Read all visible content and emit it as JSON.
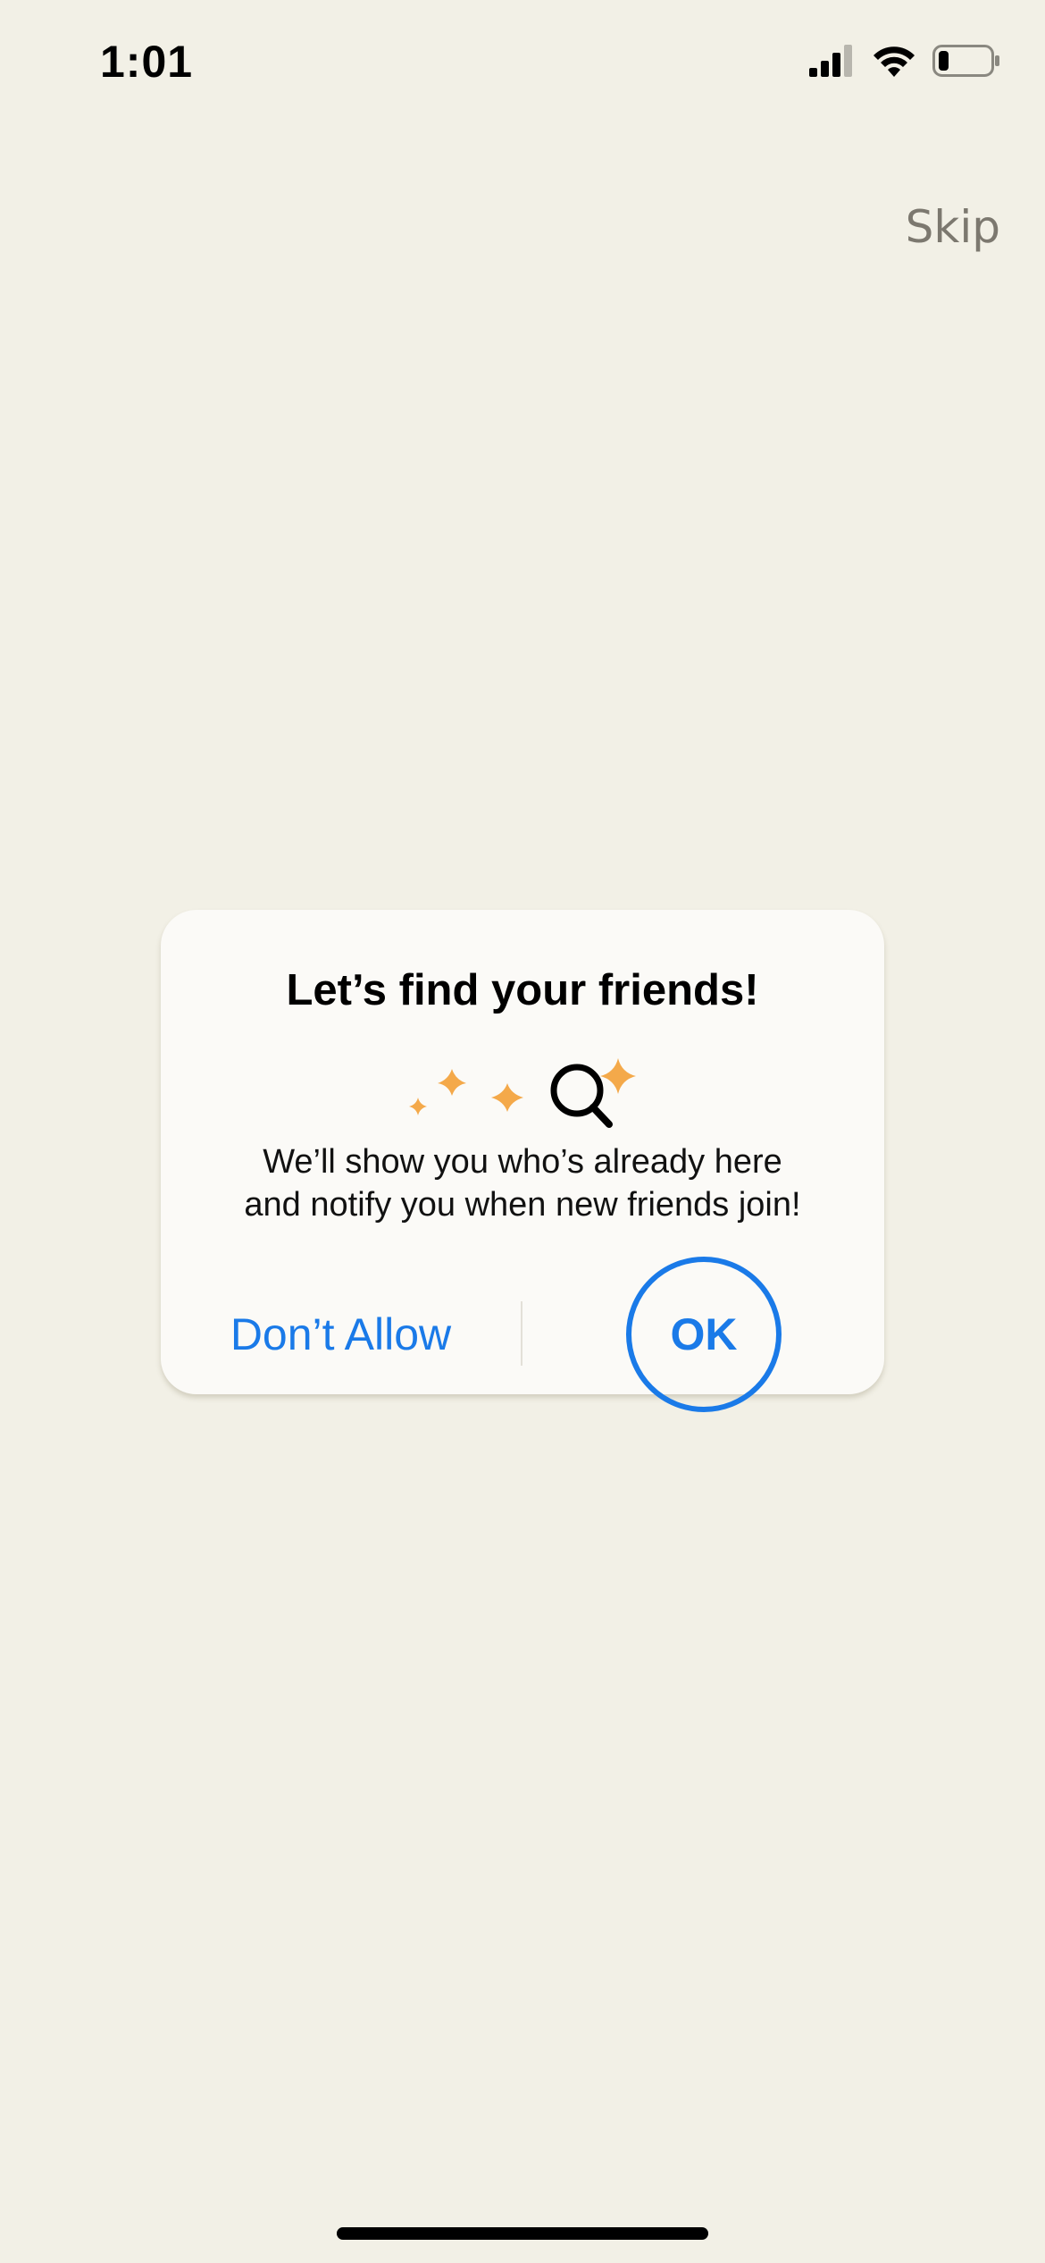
{
  "status_bar": {
    "time": "1:01",
    "icons": [
      "cellular-signal-icon",
      "wifi-icon",
      "battery-icon"
    ],
    "battery_level": 0.2
  },
  "header": {
    "skip_label": "Skip"
  },
  "dialog": {
    "title": "Let’s find your friends!",
    "illustration_icons": [
      "sparkle-icon",
      "sparkle-icon",
      "sparkle-icon",
      "magnifier-icon",
      "sparkle-icon"
    ],
    "message_lines": [
      "We’ll show you who’s already here",
      "and notify you when new friends join!"
    ],
    "buttons": {
      "dont_allow": "Don’t Allow",
      "ok": "OK"
    }
  },
  "colors": {
    "background": "#f2f0e6",
    "dialog_background": "#fbfaf7",
    "accent_blue": "#1a7ae8",
    "sparkle_orange": "#f4a94a",
    "skip_gray": "#7c786f"
  }
}
